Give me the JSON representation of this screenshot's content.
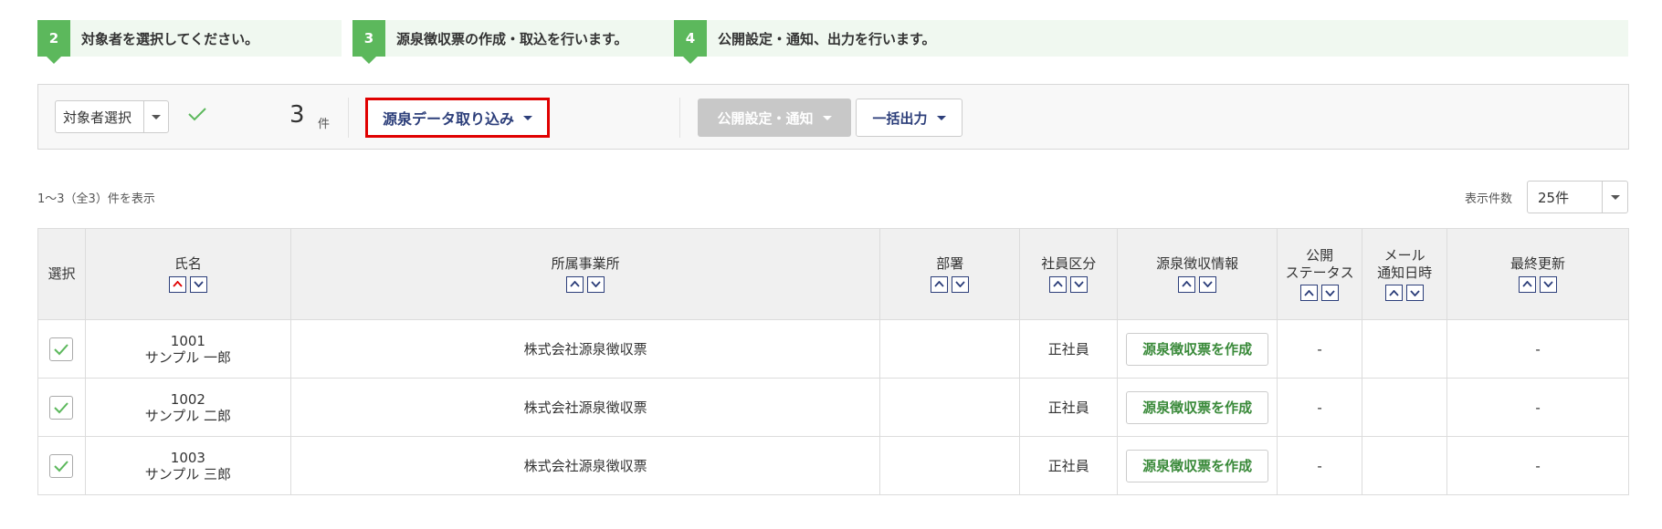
{
  "steps": [
    {
      "num": "2",
      "text": "対象者を選択してください。"
    },
    {
      "num": "3",
      "text": "源泉徴収票の作成・取込を行います。"
    },
    {
      "num": "4",
      "text": "公開設定・通知、出力を行います。"
    }
  ],
  "toolbar": {
    "target_select_label": "対象者選択",
    "selected_count": "3",
    "count_unit": "件",
    "import_label": "源泉データ取り込み",
    "publish_label": "公開設定・通知",
    "bulk_output_label": "一括出力"
  },
  "summary_text": "1〜3（全3）件を表示",
  "per_page": {
    "label": "表示件数",
    "value": "25件"
  },
  "table": {
    "headers": {
      "select": "選択",
      "name": "氏名",
      "office": "所属事業所",
      "dept": "部署",
      "emp_type": "社員区分",
      "withholding": "源泉徴収情報",
      "pub_status_1": "公開",
      "pub_status_2": "ステータス",
      "mail_1": "メール",
      "mail_2": "通知日時",
      "updated": "最終更新"
    },
    "rows": [
      {
        "checked": true,
        "id": "1001",
        "name": "サンプル 一郎",
        "office": "株式会社源泉徴収票",
        "dept": "",
        "emp_type": "正社員",
        "action": "源泉徴収票を作成",
        "status": "-",
        "mail": "",
        "updated": "-"
      },
      {
        "checked": true,
        "id": "1002",
        "name": "サンプル 二郎",
        "office": "株式会社源泉徴収票",
        "dept": "",
        "emp_type": "正社員",
        "action": "源泉徴収票を作成",
        "status": "-",
        "mail": "",
        "updated": "-"
      },
      {
        "checked": true,
        "id": "1003",
        "name": "サンプル 三郎",
        "office": "株式会社源泉徴収票",
        "dept": "",
        "emp_type": "正社員",
        "action": "源泉徴収票を作成",
        "status": "-",
        "mail": "",
        "updated": "-"
      }
    ]
  },
  "colors": {
    "step_green": "#5cb85c",
    "highlight_red": "#e00000",
    "nav_blue": "#2c3e7a",
    "action_green": "#3a8a3a"
  }
}
